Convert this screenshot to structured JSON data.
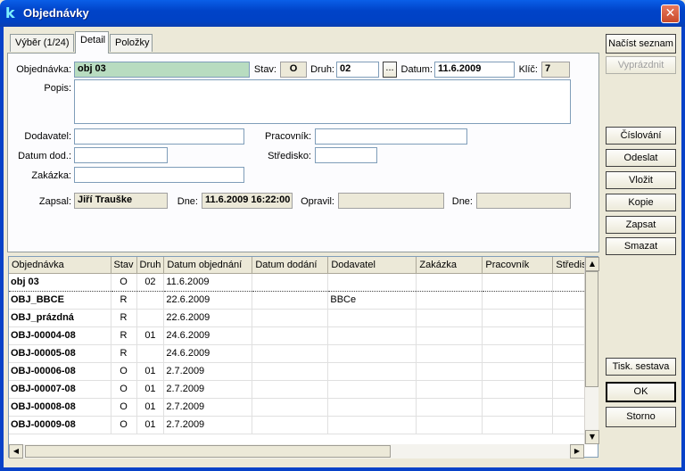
{
  "window": {
    "title": "Objednávky",
    "icon": "k"
  },
  "tabs": [
    {
      "label": "Výběr (1/24)"
    },
    {
      "label": "Detail"
    },
    {
      "label": "Položky"
    }
  ],
  "form": {
    "objednavka_label": "Objednávka:",
    "objednavka_value": "obj 03",
    "stav_label": "Stav:",
    "stav_value": "O",
    "druh_label": "Druh:",
    "druh_value": "02",
    "druh_browse": "...",
    "datum_label": "Datum:",
    "datum_value": "11.6.2009",
    "klic_label": "Klíč:",
    "klic_value": "7",
    "popis_label": "Popis:",
    "popis_value": "",
    "dodavatel_label": "Dodavatel:",
    "dodavatel_value": "",
    "pracovnik_label": "Pracovník:",
    "pracovnik_value": "",
    "datum_dod_label": "Datum dod.:",
    "datum_dod_value": "",
    "stredisko_label": "Středisko:",
    "stredisko_value": "",
    "zakazka_label": "Zakázka:",
    "zakazka_value": "",
    "zapsal_label": "Zapsal:",
    "zapsal_value": "Jiří Trauške",
    "dne1_label": "Dne:",
    "dne1_value": "11.6.2009 16:22:00",
    "opravil_label": "Opravil:",
    "opravil_value": "",
    "dne2_label": "Dne:",
    "dne2_value": ""
  },
  "buttons": {
    "nacist": "Načíst seznam",
    "vyprazdnit": "Vyprázdnit",
    "cislovani": "Číslování",
    "odeslat": "Odeslat",
    "vlozit": "Vložit",
    "kopie": "Kopie",
    "zapsat": "Zapsat",
    "smazat": "Smazat",
    "tisk": "Tisk. sestava",
    "ok": "OK",
    "storno": "Storno"
  },
  "grid": {
    "columns": [
      "Objednávka",
      "Stav",
      "Druh",
      "Datum objednání",
      "Datum dodání",
      "Dodavatel",
      "Zakázka",
      "Pracovník",
      "Středis"
    ],
    "rows": [
      [
        "obj 03",
        "O",
        "02",
        "11.6.2009",
        "",
        "",
        "",
        "",
        ""
      ],
      [
        "OBJ_BBCE",
        "R",
        "",
        "22.6.2009",
        "",
        "BBCe",
        "",
        "",
        ""
      ],
      [
        "OBJ_prázdná",
        "R",
        "",
        "22.6.2009",
        "",
        "",
        "",
        "",
        ""
      ],
      [
        "OBJ-00004-08",
        "R",
        "01",
        "24.6.2009",
        "",
        "",
        "",
        "",
        ""
      ],
      [
        "OBJ-00005-08",
        "R",
        "",
        "24.6.2009",
        "",
        "",
        "",
        "",
        ""
      ],
      [
        "OBJ-00006-08",
        "O",
        "01",
        "2.7.2009",
        "",
        "",
        "",
        "",
        ""
      ],
      [
        "OBJ-00007-08",
        "O",
        "01",
        "2.7.2009",
        "",
        "",
        "",
        "",
        ""
      ],
      [
        "OBJ-00008-08",
        "O",
        "01",
        "2.7.2009",
        "",
        "",
        "",
        "",
        ""
      ],
      [
        "OBJ-00009-08",
        "O",
        "01",
        "2.7.2009",
        "",
        "",
        "",
        "",
        ""
      ]
    ]
  }
}
